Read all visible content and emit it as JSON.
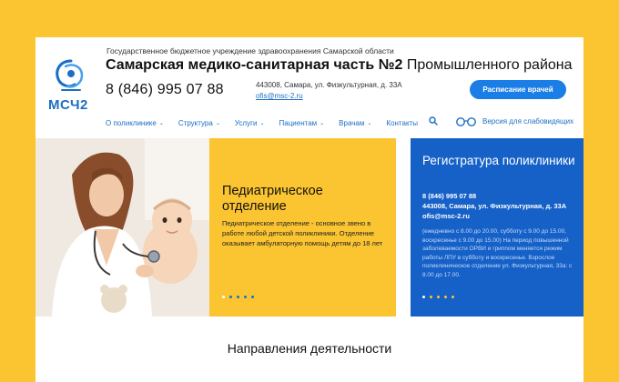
{
  "header": {
    "org_subtitle": "Государственное бюджетное учреждение здравоохранения Самарской области",
    "org_title_bold": "Самарская медико-санитарная часть №2",
    "org_title_rest": " Промышленного района",
    "phone": "8 (846) 995 07 88",
    "address": "443008, Самара, ул. Физкультурная, д. 33А",
    "email": "ofis@msc-2.ru",
    "schedule_button": "Расписание врачей",
    "logo_text": "МСЧ2"
  },
  "nav": {
    "items": [
      {
        "label": "О поликлинике",
        "dropdown": true
      },
      {
        "label": "Структура",
        "dropdown": true
      },
      {
        "label": "Услуги",
        "dropdown": true
      },
      {
        "label": "Пациентам",
        "dropdown": true
      },
      {
        "label": "Врачам",
        "dropdown": true
      },
      {
        "label": "Контакты",
        "dropdown": false
      }
    ],
    "vision_label": "Версия для слабовидящих",
    "search_icon": "search-icon",
    "glasses_icon": "glasses-icon"
  },
  "hero": {
    "title": "Педиатрическое отделение",
    "text": "Педиатрическое отделение - основное звено в работе любой детской поликлиники. Отделение оказывает амбулаторную помощь детям до 18 лет"
  },
  "registry": {
    "title": "Регистратура поликлиники",
    "phone": "8 (846) 995 07 88",
    "address": "443008, Самара, ул. Физкультурная, д. 33А",
    "email": "ofis@msc-2.ru",
    "info": "(ежедневно с 8.00 до 20.00, субботу с 9.00 до 15.00, воскресенье с 9.00 до 15.00) На период повышенной заболеваемости ОРВИ и гриппом меняется режим работы ЛПУ в субботу и воскресенье. Взрослое поликлиническое отделение ул. Физкультурная, 33а: с 8.00 до 17.00."
  },
  "sections": {
    "directions_title": "Направления деятельности"
  },
  "colors": {
    "background": "#fbc431",
    "accent_blue": "#1a7ee6",
    "registry_blue": "#1661c7",
    "link_blue": "#1a6fc4"
  }
}
